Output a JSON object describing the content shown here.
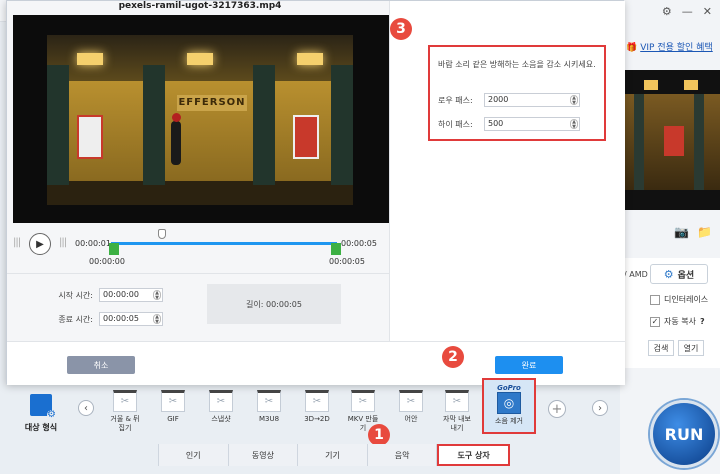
{
  "dialog": {
    "title": "pexels-ramil-ugot-3217363.mp4",
    "video_sign": "EFFERSON",
    "timeline": {
      "current_time": "00:00:01",
      "end_time": "00:00:05",
      "start_marker": "00:00:00",
      "end_marker": "00:00:05"
    },
    "start_time_label": "시작 시간:",
    "start_time_value": "00:00:00",
    "end_time_label": "종료 시간:",
    "end_time_value": "00:00:05",
    "length_text": "길이:  00:00:05",
    "noise": {
      "description": "바람 소리 같은 방해하는 소음을 감소 시키세요.",
      "lowpass_label": "로우 패스:",
      "lowpass_value": "2000",
      "highpass_label": "하이 패스:",
      "highpass_value": "500"
    },
    "cancel_label": "취소",
    "ok_label": "완료"
  },
  "badges": {
    "b1": "1",
    "b2": "2",
    "b3": "3"
  },
  "background": {
    "vip_text": "VIP 전용 할인 혜택",
    "amd": "/ AMD",
    "options_label": "옵션",
    "deinterlace_label": "디인터레이스",
    "autocopy_label": "자동 복사",
    "autocopy_help": "?",
    "btn_browse": "검색",
    "btn_open": "열기"
  },
  "toolbar": {
    "target_label": "대상 형식",
    "tools": [
      {
        "label": "거울 & 뒤\n집기"
      },
      {
        "label": "GIF"
      },
      {
        "label": "스냅샷"
      },
      {
        "label": "M3U8"
      },
      {
        "label": "3D→2D"
      },
      {
        "label": "MKV 만들\n기"
      },
      {
        "label": "어안"
      },
      {
        "label": "자막 내보\n내기"
      },
      {
        "label": "소음 제거",
        "brand": "GoPro"
      }
    ],
    "run_label": "RUN"
  },
  "tabs": [
    {
      "label": "인기"
    },
    {
      "label": "동영상"
    },
    {
      "label": "기기"
    },
    {
      "label": "음악"
    },
    {
      "label": "도구 상자",
      "active": true
    }
  ]
}
